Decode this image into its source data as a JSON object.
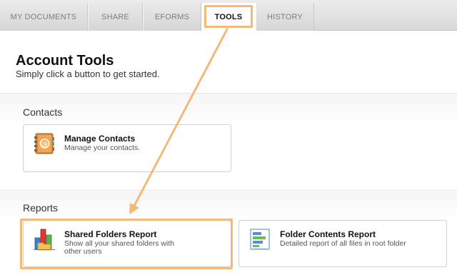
{
  "tabs": [
    {
      "label": "MY DOCUMENTS"
    },
    {
      "label": "SHARE"
    },
    {
      "label": "EFORMS"
    },
    {
      "label": "TOOLS"
    },
    {
      "label": "HISTORY"
    }
  ],
  "header": {
    "title": "Account Tools",
    "subtitle": "Simply click a button to get started."
  },
  "contacts": {
    "section_title": "Contacts",
    "manage": {
      "title": "Manage Contacts",
      "description": "Manage your contacts.",
      "icon": "address-book-icon"
    }
  },
  "reports": {
    "section_title": "Reports",
    "shared": {
      "title": "Shared Folders Report",
      "description": "Show all your shared folders with other users",
      "icon": "shared-folders-chart-icon"
    },
    "folder": {
      "title": "Folder Contents Report",
      "description": "Detailed report of all files in root folder",
      "icon": "folder-contents-report-icon"
    }
  },
  "colors": {
    "highlight": "#f4b97a",
    "arrow": "#f4b97a"
  }
}
